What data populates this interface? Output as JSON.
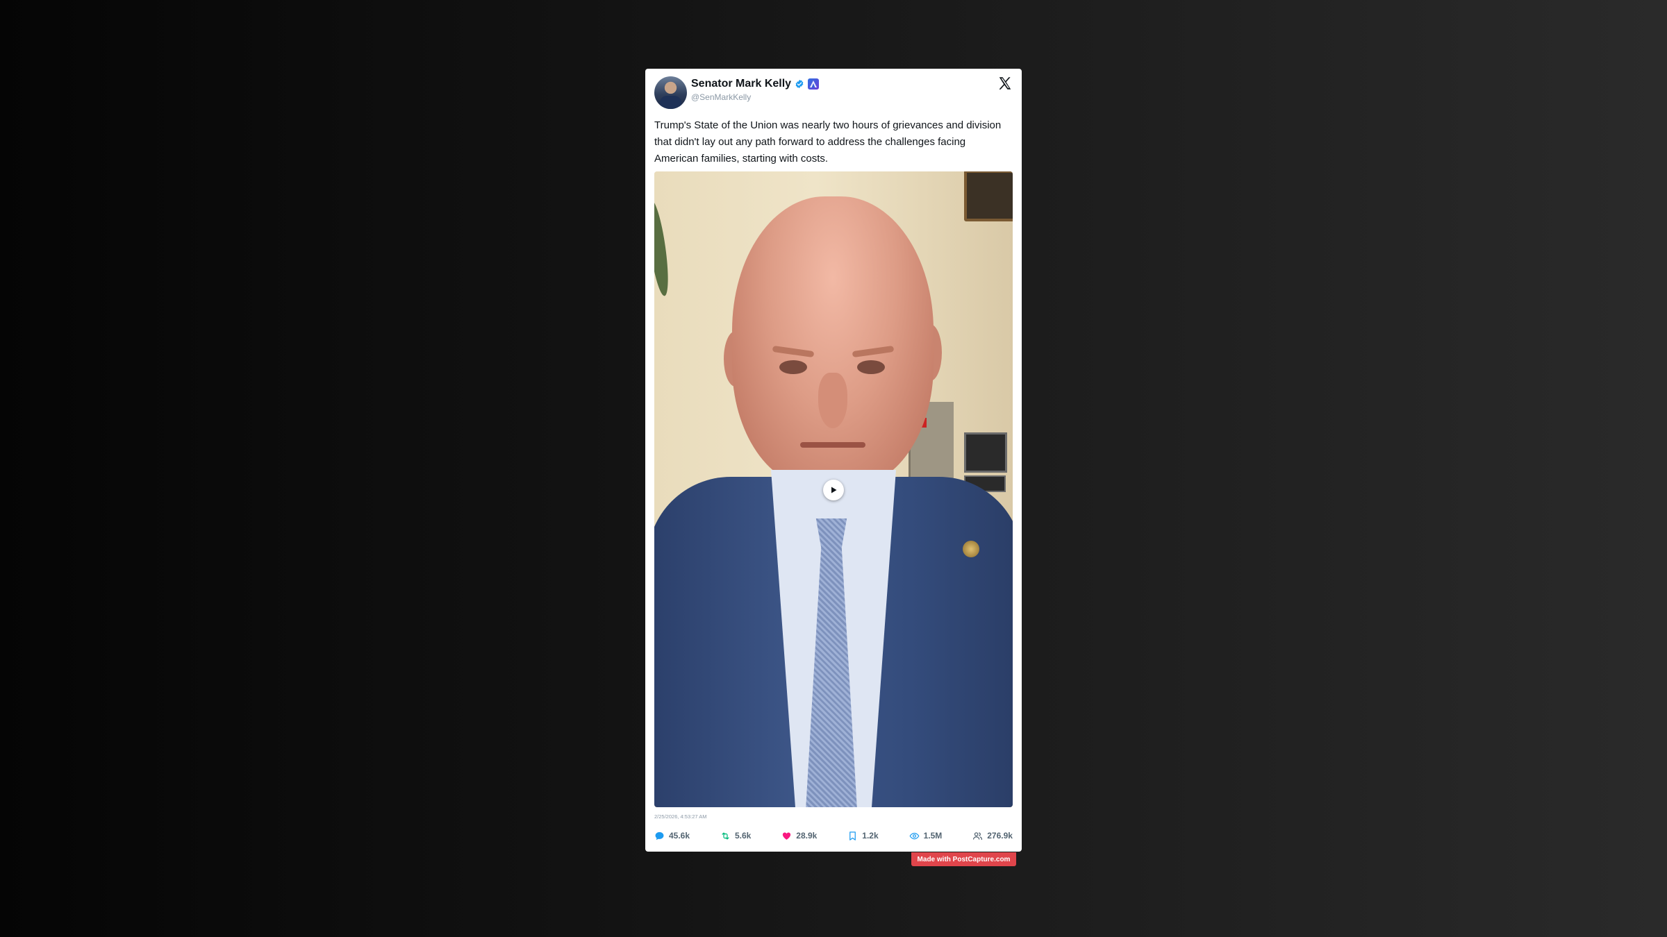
{
  "post": {
    "author_name": "Senator Mark Kelly",
    "handle": "@SenMarkKelly",
    "text": "Trump's State of the Union was nearly two hours of grievances and division that didn't lay out any path forward to address the challenges facing American families, starting with costs.",
    "timestamp": "2/25/2026, 4:53:27 AM",
    "platform_icon": "x-logo-icon",
    "media": {
      "type": "video",
      "icon": "play-icon"
    }
  },
  "stats": {
    "replies": "45.6k",
    "reposts": "5.6k",
    "likes": "28.9k",
    "bookmarks": "1.2k",
    "views": "1.5M",
    "followers": "276.9k"
  },
  "colors": {
    "reply": "#1d9bf0",
    "repost": "#00ba7c",
    "like": "#f91880",
    "bookmark": "#1d9bf0",
    "views": "#1d9bf0",
    "followers": "#536471",
    "watermark_bg": "#e0454b"
  },
  "watermark": {
    "label": "Made with PostCapture.com"
  }
}
